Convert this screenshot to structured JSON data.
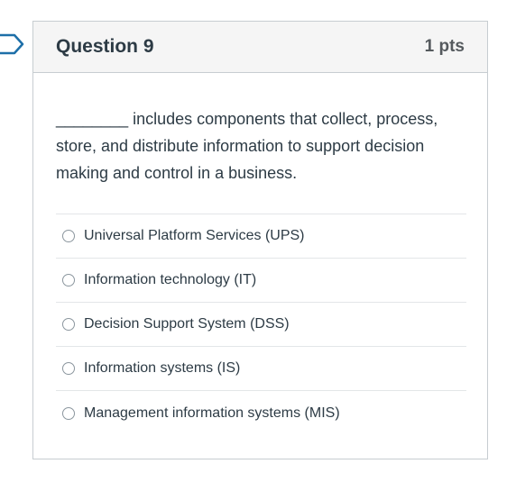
{
  "question": {
    "title": "Question 9",
    "points": "1 pts",
    "text": "________ includes components that collect, process, store, and distribute information to support decision making and control in a business."
  },
  "answers": [
    {
      "label": "Universal Platform Services (UPS)"
    },
    {
      "label": "Information technology (IT)"
    },
    {
      "label": "Decision Support System (DSS)"
    },
    {
      "label": "Information systems (IS)"
    },
    {
      "label": "Management information systems (MIS)"
    }
  ],
  "colors": {
    "header_bg": "#f5f5f5",
    "border": "#c7cdd1",
    "text": "#2d3b45",
    "flag": "#1d6fa8"
  }
}
